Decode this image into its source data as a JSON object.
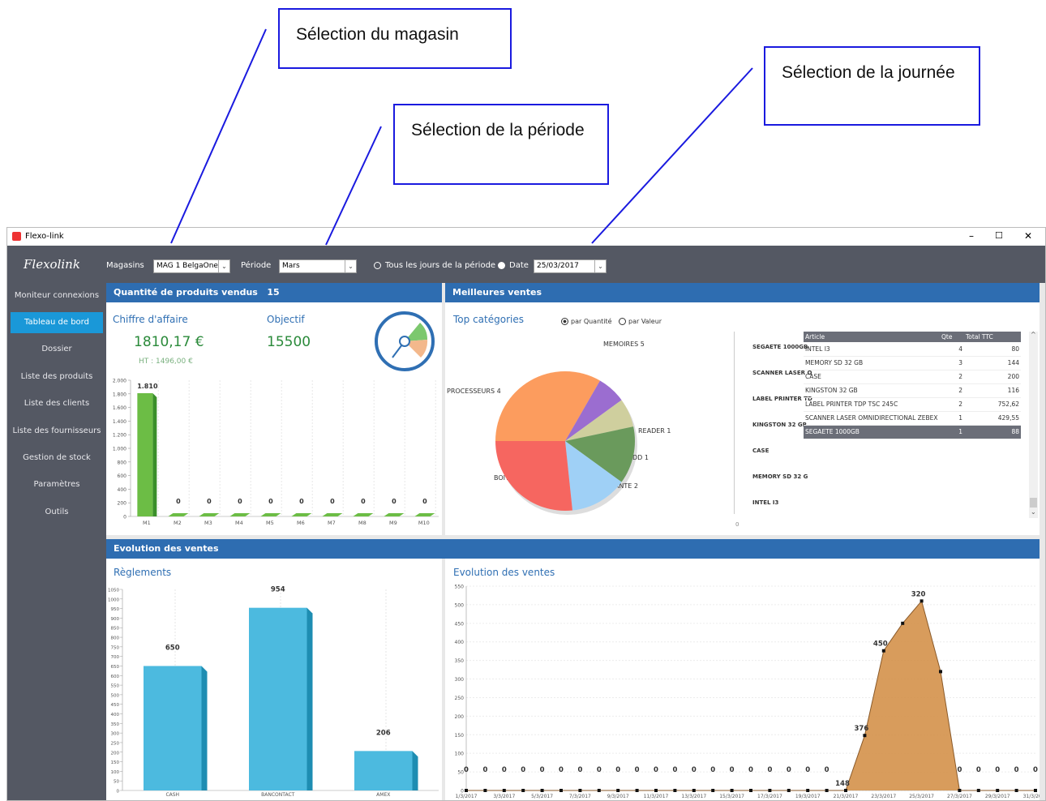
{
  "annotations": {
    "store": "Sélection du magasin",
    "period": "Sélection de la période",
    "day": "Sélection de la journée"
  },
  "window": {
    "title": "Flexo-link",
    "controls": {
      "minimize": "–",
      "maximize": "☐",
      "close": "✕"
    }
  },
  "toolbar": {
    "brand": "Flexolink",
    "store_label": "Magasins",
    "store_value": "MAG 1 BelgaOne",
    "period_label": "Période",
    "period_value": "Mars",
    "all_days_label": "Tous les jours de la période",
    "date_label": "Date",
    "date_value": "25/03/2017"
  },
  "sidebar": {
    "items": [
      {
        "label": "Moniteur connexions"
      },
      {
        "label": "Tableau de bord"
      },
      {
        "label": "Dossier"
      },
      {
        "label": "Liste des produits"
      },
      {
        "label": "Liste des clients"
      },
      {
        "label": "Liste des fournisseurs"
      },
      {
        "label": "Gestion de stock"
      },
      {
        "label": "Paramètres"
      },
      {
        "label": "Outils"
      }
    ]
  },
  "sales_panel": {
    "title": "Quantité de produits vendus",
    "count": "15",
    "ca_label": "Chiffre d'affaire",
    "ca_value": "1810,17 €",
    "ht_value": "HT : 1496,00 €",
    "objective_label": "Objectif",
    "objective_value": "15500"
  },
  "best_panel": {
    "title": "Meilleures ventes",
    "top_label": "Top catégories",
    "by_qty": "par Quantité",
    "by_value": "par Valeur",
    "columns": [
      "Article",
      "Qte",
      "Total TTC"
    ],
    "rows": [
      {
        "article": "INTEL I3",
        "qte": "4",
        "total": "80"
      },
      {
        "article": "MEMORY SD 32 GB",
        "qte": "3",
        "total": "144"
      },
      {
        "article": "CASE",
        "qte": "2",
        "total": "200"
      },
      {
        "article": "KINGSTON 32 GB",
        "qte": "2",
        "total": "116"
      },
      {
        "article": "LABEL PRINTER TDP TSC 245C",
        "qte": "2",
        "total": "752,62"
      },
      {
        "article": "SCANNER LASER OMNIDIRECTIONAL ZEBEX !",
        "qte": "1",
        "total": "429,55"
      },
      {
        "article": "SEGAETE 1000GB",
        "qte": "1",
        "total": "88"
      }
    ],
    "bar_labels": [
      "SEGAETE 1000GB",
      "SCANNER LASER O",
      "LABEL PRINTER TD",
      "KINGSTON 32 GB",
      "CASE",
      "MEMORY SD 32 G",
      "INTEL I3"
    ],
    "bar_axis": "0"
  },
  "evolution_panel": {
    "title": "Evolution des ventes",
    "payments_label": "Règlements",
    "evolution_label": "Evolution des ventes"
  },
  "chart_data": [
    {
      "type": "bar",
      "categories": [
        "M1",
        "M2",
        "M3",
        "M4",
        "M5",
        "M6",
        "M7",
        "M8",
        "M9",
        "M10"
      ],
      "values": [
        1810,
        0,
        0,
        0,
        0,
        0,
        0,
        0,
        0,
        0
      ],
      "data_labels": [
        "1.810",
        "0",
        "0",
        "0",
        "0",
        "0",
        "0",
        "0",
        "0",
        "0"
      ],
      "ylim": [
        0,
        2000
      ],
      "yticks": [
        "0",
        "200",
        "400",
        "600",
        "800",
        "1.000",
        "1.200",
        "1.400",
        "1.600",
        "1.800",
        "2.000"
      ],
      "colors": {
        "main": "#6cbd45",
        "side": "#3a8f2a"
      }
    },
    {
      "type": "pie",
      "slices": [
        {
          "label": "MEMOIRES 5",
          "value": 5,
          "color": "#fc9c5e"
        },
        {
          "label": "READER 1",
          "value": 1,
          "color": "#9b6dd0"
        },
        {
          "label": "HDD 1",
          "value": 1,
          "color": "#cfcf9e"
        },
        {
          "label": "IMPRIMANTE 2",
          "value": 2,
          "color": "#6a9a5c"
        },
        {
          "label": "BOITIER 2",
          "value": 2,
          "color": "#9fd0f6"
        },
        {
          "label": "PROCESSEURS 4",
          "value": 4,
          "color": "#f66660"
        }
      ]
    },
    {
      "type": "bar",
      "categories": [
        "CASH",
        "BANCONTACT",
        "AMEX"
      ],
      "values": [
        650,
        954,
        206
      ],
      "ylim": [
        0,
        1050
      ],
      "yticks": [
        "0",
        "50",
        "100",
        "150",
        "200",
        "250",
        "300",
        "350",
        "400",
        "450",
        "500",
        "550",
        "600",
        "650",
        "700",
        "750",
        "800",
        "850",
        "900",
        "950",
        "1000",
        "1050"
      ],
      "colors": {
        "main": "#4cbadf",
        "side": "#1e8db2"
      }
    },
    {
      "type": "area",
      "x": [
        "1/3/2017",
        "2/3/2017",
        "3/3/2017",
        "4/3/2017",
        "5/3/2017",
        "6/3/2017",
        "7/3/2017",
        "8/3/2017",
        "9/3/2017",
        "10/3/2017",
        "11/3/2017",
        "12/3/2017",
        "13/3/2017",
        "14/3/2017",
        "15/3/2017",
        "16/3/2017",
        "17/3/2017",
        "18/3/2017",
        "19/3/2017",
        "20/3/2017",
        "21/3/2017",
        "22/3/2017",
        "23/3/2017",
        "24/3/2017",
        "25/3/2017",
        "26/3/2017",
        "27/3/2017",
        "28/3/2017",
        "29/3/2017",
        "30/3/2017",
        "31/3/2017"
      ],
      "xtick_labels": [
        "1/3/2017",
        "3/3/2017",
        "5/3/2017",
        "7/3/2017",
        "9/3/2017",
        "11/3/2017",
        "13/3/2017",
        "15/3/2017",
        "17/3/2017",
        "19/3/2017",
        "21/3/2017",
        "23/3/2017",
        "25/3/2017",
        "27/3/2017",
        "29/3/2017",
        "31/3/2017"
      ],
      "values": [
        0,
        0,
        0,
        0,
        0,
        0,
        0,
        0,
        0,
        0,
        0,
        0,
        0,
        0,
        0,
        0,
        0,
        0,
        0,
        0,
        0,
        148,
        376,
        450,
        510,
        320,
        0,
        0,
        0,
        0,
        0,
        0
      ],
      "data_labels": [
        "0",
        "0",
        "0",
        "0",
        "0",
        "0",
        "0",
        "0",
        "0",
        "0",
        "0",
        "0",
        "0",
        "0",
        "0",
        "0",
        "0",
        "0",
        "0",
        "0",
        "148",
        "376",
        "450",
        "",
        "320",
        "",
        "0",
        "0",
        "0",
        "0",
        "0"
      ],
      "ylim": [
        0,
        550
      ],
      "yticks": [
        "0",
        "50",
        "100",
        "150",
        "200",
        "250",
        "300",
        "350",
        "400",
        "450",
        "500",
        "550"
      ],
      "color": "#d4914a"
    }
  ]
}
